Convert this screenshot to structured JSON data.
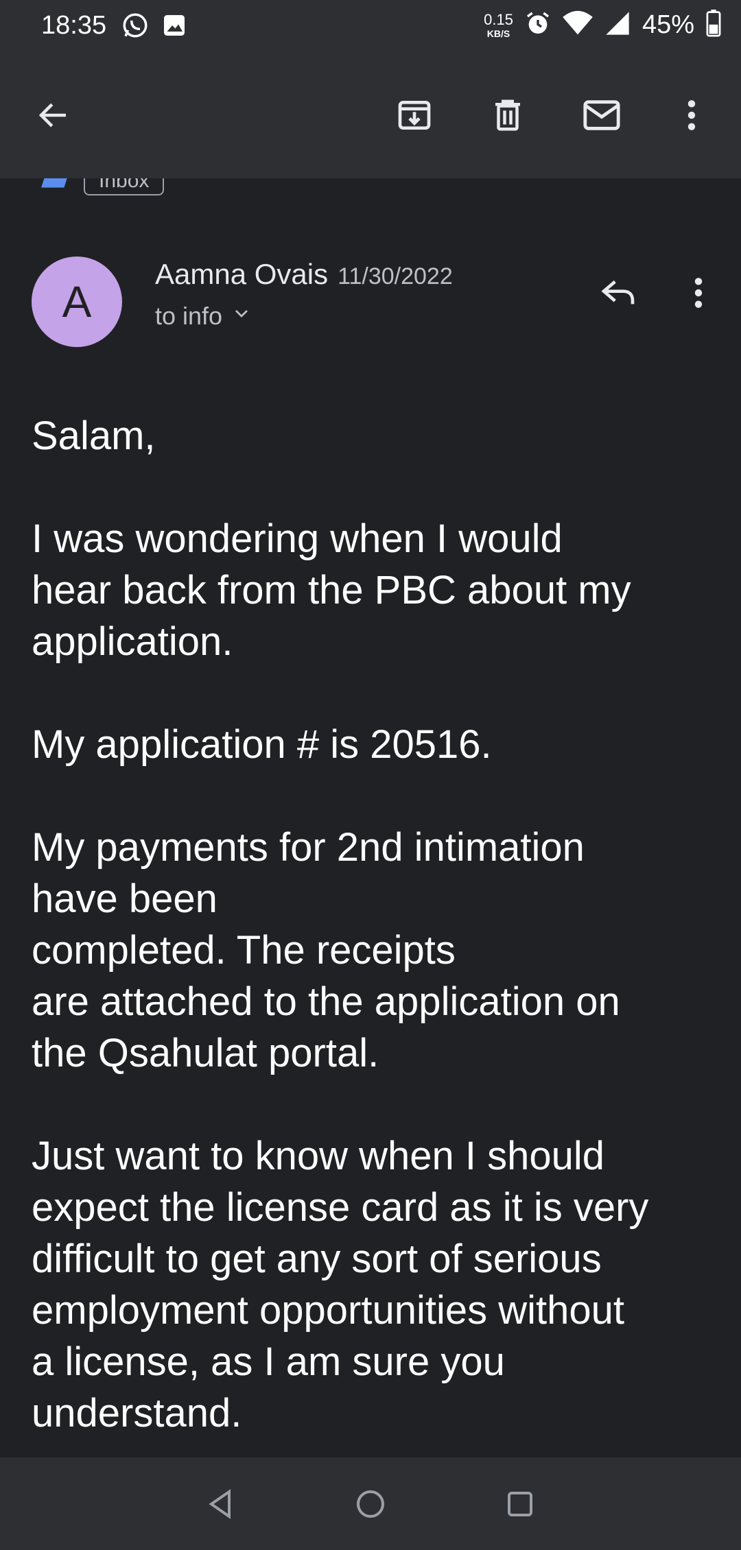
{
  "status_bar": {
    "time": "18:35",
    "net_speed": "0.15",
    "net_unit": "KB/S",
    "battery": "45%",
    "icons_left": [
      "whatsapp-icon",
      "image-icon"
    ],
    "icons_right": [
      "alarm-icon",
      "wifi-icon",
      "signal-icon",
      "battery-icon"
    ]
  },
  "toolbar": {
    "icons": [
      "back-arrow-icon",
      "archive-icon",
      "delete-icon",
      "mark-unread-icon",
      "more-vert-icon"
    ]
  },
  "thread": {
    "label": "Inbox"
  },
  "message": {
    "avatar_letter": "A",
    "sender": "Aamna Ovais",
    "date": "11/30/2022",
    "recipients": "to info",
    "body": [
      "Salam,",
      "I was wondering when I would\nhear back from the PBC about my\napplication.",
      "My application # is 20516.",
      "My payments for 2nd intimation\nhave been\ncompleted. The receipts\nare attached to the application on\nthe Qsahulat portal.",
      "Just want to know when I should\nexpect the license card as it is very\ndifficult to get any sort of serious\nemployment opportunities without\na license, as I am sure you\nunderstand."
    ]
  },
  "colors": {
    "background": "#202124",
    "bar": "#2d2f33",
    "avatar": "#c5a3e8",
    "label_marker": "#5b8def"
  }
}
